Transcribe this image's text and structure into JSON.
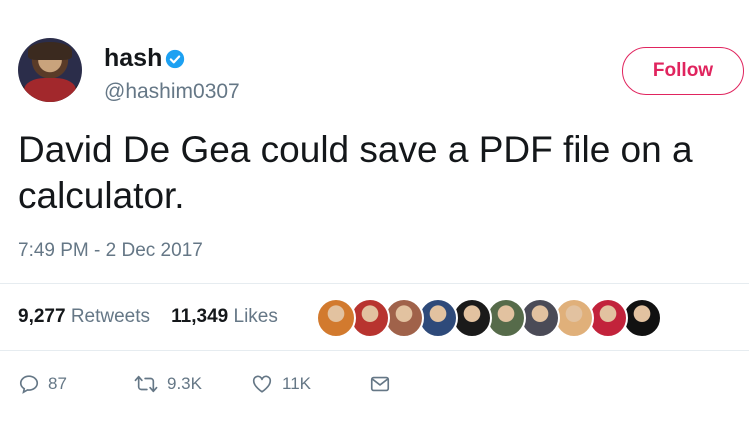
{
  "user": {
    "name": "hash",
    "handle": "@hashim0307",
    "verified": true,
    "avatar_icon": "user-avatar-icon"
  },
  "follow_button": {
    "label": "Follow",
    "color": "#e0245e"
  },
  "tweet": {
    "text": "David De Gea could save a PDF file on a calculator.",
    "timestamp": "7:49 PM - 2 Dec 2017"
  },
  "stats": {
    "retweets_count": "9,277",
    "retweets_label": "Retweets",
    "likes_count": "11,349",
    "likes_label": "Likes",
    "liker_avatars": [
      "#d27a2e",
      "#b8342f",
      "#a0624a",
      "#2e4a7a",
      "#1a1a1a",
      "#566b4a",
      "#4b4b57",
      "#e0b07a",
      "#c2233b",
      "#111111"
    ]
  },
  "actions": {
    "reply_count": "87",
    "retweet_count": "9.3K",
    "like_count": "11K"
  },
  "colors": {
    "text": "#14171a",
    "secondary": "#657786",
    "verified": "#1da1f2"
  }
}
